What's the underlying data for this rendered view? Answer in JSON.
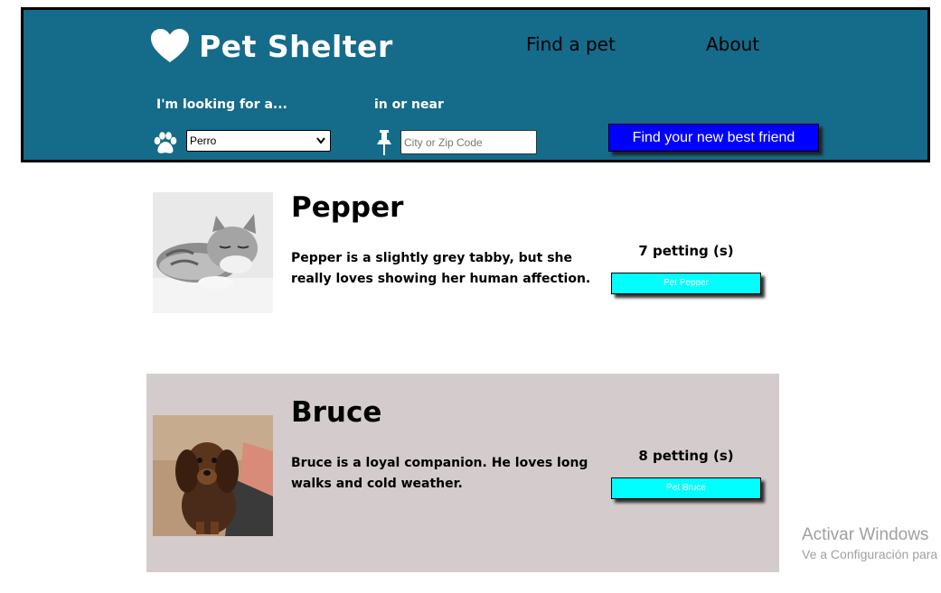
{
  "header": {
    "brand_title": "Pet Shelter",
    "nav": {
      "find": "Find a pet",
      "about": "About"
    },
    "search": {
      "looking_label": "I'm looking for a...",
      "near_label": "in or near",
      "species_selected": "Perro",
      "zip_placeholder": "City or Zip Code",
      "submit_label": "Find your new best friend"
    }
  },
  "pets": [
    {
      "name": "Pepper",
      "description": "Pepper is a slightly grey tabby, but she really loves showing her human affection.",
      "petting_count": "7 petting (s)",
      "button_label": "Pet Pepper"
    },
    {
      "name": "Bruce",
      "description": "Bruce is a loyal companion. He loves long walks and cold weather.",
      "petting_count": "8 petting (s)",
      "button_label": "Pet Bruce"
    }
  ],
  "watermark": {
    "title": "Activar Windows",
    "subtitle": "Ve a Configuración para"
  },
  "colors": {
    "header_bg": "#156b8a",
    "primary_button": "#0000ff",
    "pet_button": "#00ffff",
    "alt_card_bg": "#d4cccc"
  },
  "icons": {
    "brand": "heart-icon",
    "species": "paw-icon",
    "location": "pushpin-icon",
    "select": "chevron-down-icon"
  }
}
